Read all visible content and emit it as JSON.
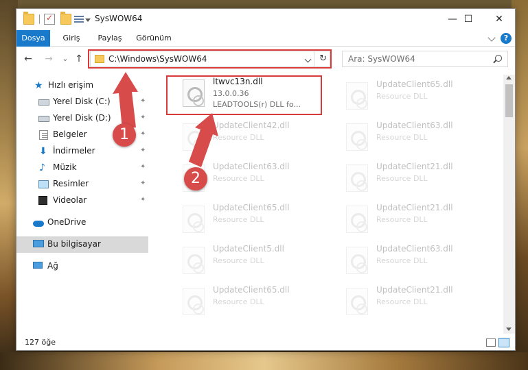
{
  "window": {
    "title": "SysWOW64",
    "controls": {
      "minimize": "—",
      "maximize": "☐",
      "close": "✕"
    }
  },
  "ribbon": {
    "tabs": [
      {
        "label": "Dosya",
        "active": true
      },
      {
        "label": "Giriş"
      },
      {
        "label": "Paylaş"
      },
      {
        "label": "Görünüm"
      }
    ],
    "help_label": "?"
  },
  "nav": {
    "back": "←",
    "forward": "→",
    "recent": "⌄",
    "up": "↑",
    "address": "C:\\Windows\\SysWOW64",
    "refresh": "↻",
    "search_placeholder": "Ara: SysWOW64"
  },
  "navpane": {
    "items": [
      {
        "label": "Hızlı erişim",
        "icon": "star-icon"
      },
      {
        "label": "Yerel Disk (C:)",
        "icon": "drive-icon",
        "pinned": true
      },
      {
        "label": "Yerel Disk (D:)",
        "icon": "drive-icon",
        "pinned": true
      },
      {
        "label": "Belgeler",
        "icon": "documents-icon",
        "pinned": true
      },
      {
        "label": "İndirmeler",
        "icon": "download-icon",
        "pinned": true
      },
      {
        "label": "Müzik",
        "icon": "music-icon",
        "pinned": true
      },
      {
        "label": "Resimler",
        "icon": "pictures-icon",
        "pinned": true
      },
      {
        "label": "Videolar",
        "icon": "videos-icon",
        "pinned": true
      },
      {
        "label": "OneDrive",
        "icon": "cloud-icon"
      },
      {
        "label": "Bu bilgisayar",
        "icon": "computer-icon",
        "selected": true
      },
      {
        "label": "Ağ",
        "icon": "network-icon"
      }
    ],
    "pin_glyph": "📌"
  },
  "files": {
    "highlighted": {
      "name": "ltwvc13n.dll",
      "version": "13.0.0.36",
      "description": "LEADTOOLS(r) DLL fo..."
    },
    "left_column": [
      {
        "name": "UpdateClient42.dll",
        "desc": "Resource DLL"
      },
      {
        "name": "UpdateClient63.dll",
        "desc": "Resource DLL"
      },
      {
        "name": "UpdateClient65.dll",
        "desc": "Resource DLL"
      },
      {
        "name": "UpdateClient5.dll",
        "desc": "Resource DLL"
      },
      {
        "name": "UpdateClient65.dll",
        "desc": "Resource DLL"
      }
    ],
    "right_column": [
      {
        "name": "UpdateClient65.dll",
        "desc": "Resource DLL"
      },
      {
        "name": "UpdateClient63.dll",
        "desc": "Resource DLL"
      },
      {
        "name": "UpdateClient21.dll",
        "desc": "Resource DLL"
      },
      {
        "name": "UpdateClient21.dll",
        "desc": "Resource DLL"
      },
      {
        "name": "UpdateClient63.dll",
        "desc": "Resource DLL"
      },
      {
        "name": "UpdateClient21.dll",
        "desc": "Resource DLL"
      }
    ]
  },
  "status": {
    "count": "127 öğe"
  },
  "annotations": {
    "step1": "1",
    "step2": "2",
    "color": "#d83a3a"
  }
}
